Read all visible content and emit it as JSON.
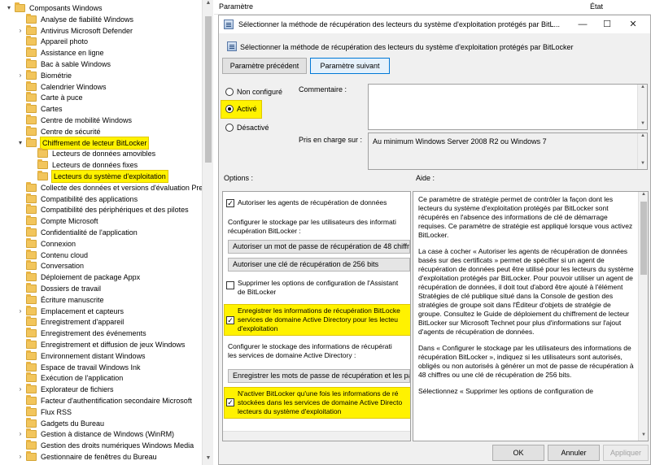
{
  "tree": {
    "rows": [
      {
        "label": "Composants Windows",
        "arrow": "▾",
        "indent": 0,
        "highlight": false
      },
      {
        "label": "Analyse de fiabilité Windows",
        "arrow": "",
        "indent": 1,
        "highlight": false
      },
      {
        "label": "Antivirus Microsoft Defender",
        "arrow": "›",
        "indent": 1,
        "highlight": false
      },
      {
        "label": "Appareil photo",
        "arrow": "",
        "indent": 1,
        "highlight": false
      },
      {
        "label": "Assistance en ligne",
        "arrow": "",
        "indent": 1,
        "highlight": false
      },
      {
        "label": "Bac à sable Windows",
        "arrow": "",
        "indent": 1,
        "highlight": false
      },
      {
        "label": "Biométrie",
        "arrow": "›",
        "indent": 1,
        "highlight": false
      },
      {
        "label": "Calendrier Windows",
        "arrow": "",
        "indent": 1,
        "highlight": false
      },
      {
        "label": "Carte à puce",
        "arrow": "",
        "indent": 1,
        "highlight": false
      },
      {
        "label": "Cartes",
        "arrow": "",
        "indent": 1,
        "highlight": false
      },
      {
        "label": "Centre de mobilité Windows",
        "arrow": "",
        "indent": 1,
        "highlight": false
      },
      {
        "label": "Centre de sécurité",
        "arrow": "",
        "indent": 1,
        "highlight": false
      },
      {
        "label": "Chiffrement de lecteur BitLocker",
        "arrow": "▾",
        "indent": 1,
        "highlight": true
      },
      {
        "label": "Lecteurs de données amovibles",
        "arrow": "",
        "indent": 2,
        "highlight": false
      },
      {
        "label": "Lecteurs de données fixes",
        "arrow": "",
        "indent": 2,
        "highlight": false
      },
      {
        "label": "Lecteurs du système d'exploitation",
        "arrow": "",
        "indent": 2,
        "highlight": true
      },
      {
        "label": "Collecte des données et versions d'évaluation Pre",
        "arrow": "",
        "indent": 1,
        "highlight": false
      },
      {
        "label": "Compatibilité des applications",
        "arrow": "",
        "indent": 1,
        "highlight": false
      },
      {
        "label": "Compatibilité des périphériques et des pilotes",
        "arrow": "",
        "indent": 1,
        "highlight": false
      },
      {
        "label": "Compte Microsoft",
        "arrow": "",
        "indent": 1,
        "highlight": false
      },
      {
        "label": "Confidentialité de l'application",
        "arrow": "",
        "indent": 1,
        "highlight": false
      },
      {
        "label": "Connexion",
        "arrow": "",
        "indent": 1,
        "highlight": false
      },
      {
        "label": "Contenu cloud",
        "arrow": "",
        "indent": 1,
        "highlight": false
      },
      {
        "label": "Conversation",
        "arrow": "",
        "indent": 1,
        "highlight": false
      },
      {
        "label": "Déploiement de package Appx",
        "arrow": "",
        "indent": 1,
        "highlight": false
      },
      {
        "label": "Dossiers de travail",
        "arrow": "",
        "indent": 1,
        "highlight": false
      },
      {
        "label": "Écriture manuscrite",
        "arrow": "",
        "indent": 1,
        "highlight": false
      },
      {
        "label": "Emplacement et capteurs",
        "arrow": "›",
        "indent": 1,
        "highlight": false
      },
      {
        "label": "Enregistrement d'appareil",
        "arrow": "",
        "indent": 1,
        "highlight": false
      },
      {
        "label": "Enregistrement des événements",
        "arrow": "",
        "indent": 1,
        "highlight": false
      },
      {
        "label": "Enregistrement et diffusion de jeux Windows",
        "arrow": "",
        "indent": 1,
        "highlight": false
      },
      {
        "label": "Environnement distant Windows",
        "arrow": "",
        "indent": 1,
        "highlight": false
      },
      {
        "label": "Espace de travail Windows Ink",
        "arrow": "",
        "indent": 1,
        "highlight": false
      },
      {
        "label": "Exécution de l'application",
        "arrow": "",
        "indent": 1,
        "highlight": false
      },
      {
        "label": "Explorateur de fichiers",
        "arrow": "›",
        "indent": 1,
        "highlight": false
      },
      {
        "label": "Facteur d'authentification secondaire Microsoft",
        "arrow": "",
        "indent": 1,
        "highlight": false
      },
      {
        "label": "Flux RSS",
        "arrow": "",
        "indent": 1,
        "highlight": false
      },
      {
        "label": "Gadgets du Bureau",
        "arrow": "",
        "indent": 1,
        "highlight": false
      },
      {
        "label": "Gestion à distance de Windows (WinRM)",
        "arrow": "›",
        "indent": 1,
        "highlight": false
      },
      {
        "label": "Gestion des droits numériques Windows Media",
        "arrow": "",
        "indent": 1,
        "highlight": false
      },
      {
        "label": "Gestionnaire de fenêtres du Bureau",
        "arrow": "›",
        "indent": 1,
        "highlight": false
      }
    ]
  },
  "list_header": {
    "col1": "Paramètre",
    "col2": "État"
  },
  "dialog": {
    "title": "Sélectionner la méthode de récupération des lecteurs du système d'exploitation protégés par BitL...",
    "heading": "Sélectionner la méthode de récupération des lecteurs du système d'exploitation protégés par BitLocker",
    "prev_button": "Paramètre précédent",
    "next_button": "Paramètre suivant",
    "radio_not_configured": "Non configuré",
    "radio_enabled": "Activé",
    "radio_disabled": "Désactivé",
    "comment_label": "Commentaire :",
    "supported_label": "Pris en charge sur :",
    "supported_value": "Au minimum Windows Server 2008 R2 ou Windows 7",
    "options_label": "Options :",
    "help_label": "Aide :",
    "ok_button": "OK",
    "cancel_button": "Annuler",
    "apply_button": "Appliquer",
    "minimize": "—",
    "maximize": "☐",
    "close": "✕"
  },
  "options": {
    "allow_agents": "Autoriser les agents de récupération de données",
    "storage_line1": "Configurer le stockage par les utilisateurs des informati",
    "storage_line2": "récupération  BitLocker :",
    "combo1": "Autoriser un mot de passe de récupération de 48 chiffre",
    "combo2": "Autoriser une clé de récupération de 256 bits",
    "omit_line1": "Supprimer les options de configuration de l'Assistant",
    "omit_line2": "de BitLocker",
    "save_line1": "Enregistrer les informations de récupération BitLocke",
    "save_line2": "services de domaine Active Directory pour les lecteu",
    "save_line3": "d'exploitation",
    "ad_line1": "Configurer le stockage des informations de récupérati",
    "ad_line2": "les services de domaine Active Directory :",
    "combo3": "Enregistrer les mots de passe de récupération et les pac",
    "noenable_line1": "N'activer BitLocker qu'une fois les informations de ré",
    "noenable_line2": "stockées dans les services de domaine Active Directo",
    "noenable_line3": "lecteurs du système d'exploitation"
  },
  "help": {
    "p1": "Ce paramètre de stratégie permet de contrôler la façon dont les lecteurs du système d'exploitation protégés par BitLocker sont récupérés en l'absence des informations de clé de démarrage requises. Ce paramètre de stratégie est appliqué lorsque vous activez BitLocker.",
    "p2": "La case à cocher « Autoriser les agents de récupération de données basés sur des certificats » permet de spécifier si un agent de récupération de données peut être utilisé pour les lecteurs du système d'exploitation protégés par BitLocker. Pour pouvoir utiliser un agent de récupération de données, il doit tout d'abord être ajouté à l'élément Stratégies de clé publique situé dans la Console de gestion des stratégies de groupe soit dans l'Éditeur d'objets de stratégie de groupe. Consultez le Guide de déploiement du chiffrement de lecteur BitLocker sur Microsoft Technet pour plus d'informations sur l'ajout d'agents de récupération de données.",
    "p3": "Dans « Configurer le stockage par les utilisateurs des informations de récupération BitLocker », indiquez si les utilisateurs sont autorisés, obligés ou non autorisés à générer un mot de passe de récupération à 48 chiffres ou une clé de récupération de 256 bits.",
    "p4": "Sélectionnez « Supprimer les options de configuration de"
  },
  "colors": {
    "highlight": "#fff200",
    "accent": "#0078d7"
  }
}
